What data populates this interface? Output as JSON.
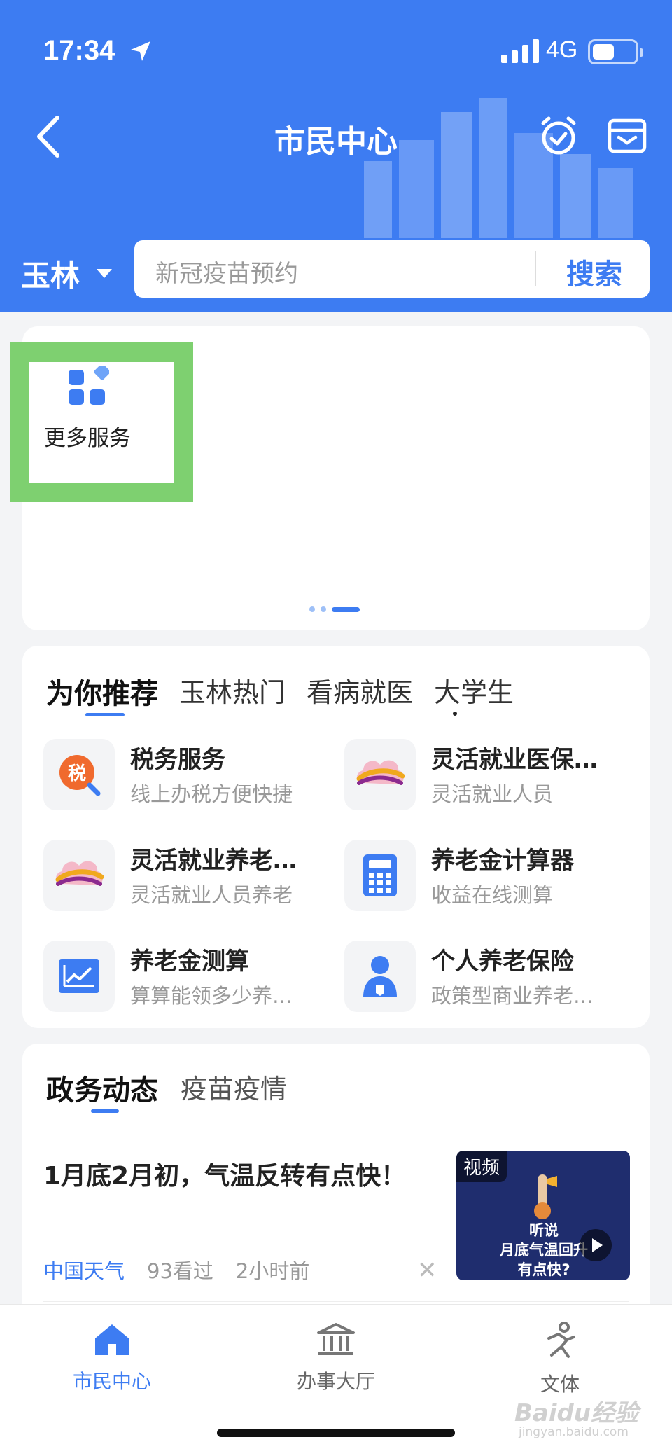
{
  "status_bar": {
    "time": "17:34",
    "network": "4G"
  },
  "header": {
    "title": "市民中心"
  },
  "city": {
    "name": "玉林"
  },
  "search": {
    "placeholder": "新冠疫苗预约",
    "button": "搜索"
  },
  "quick_services": {
    "more_label": "更多服务"
  },
  "recommend": {
    "tabs": [
      "为你推荐",
      "玉林热门",
      "看病就医",
      "大学生"
    ],
    "items": [
      {
        "title": "税务服务",
        "subtitle": "线上办税方便快捷",
        "icon": "tax-icon",
        "icon_text": "税"
      },
      {
        "title": "灵活就业医保…",
        "subtitle": "灵活就业人员",
        "icon": "cloud-logo-icon"
      },
      {
        "title": "灵活就业养老…",
        "subtitle": "灵活就业人员养老",
        "icon": "cloud-logo-icon"
      },
      {
        "title": "养老金计算器",
        "subtitle": "收益在线测算",
        "icon": "calculator-icon"
      },
      {
        "title": "养老金测算",
        "subtitle": "算算能领多少养…",
        "icon": "chart-icon"
      },
      {
        "title": "个人养老保险",
        "subtitle": "政策型商业养老…",
        "icon": "person-shield-icon"
      }
    ]
  },
  "news": {
    "tabs": [
      "政务动态",
      "疫苗疫情"
    ],
    "items": [
      {
        "title": "1月底2月初，气温反转有点快！",
        "source": "中国天气",
        "views": "93看过",
        "time": "2小时前",
        "thumb_tag": "视频",
        "thumb_caption": "听说\n月底气温回升\n有点快?"
      }
    ]
  },
  "tabbar": {
    "items": [
      {
        "label": "市民中心",
        "active": true
      },
      {
        "label": "办事大厅",
        "active": false
      },
      {
        "label": "文体",
        "active": false
      }
    ]
  },
  "watermark": {
    "text": "Baidu经验",
    "sub": "jingyan.baidu.com"
  },
  "colors": {
    "brand": "#3d7cf2",
    "highlight": "#7ed070"
  }
}
